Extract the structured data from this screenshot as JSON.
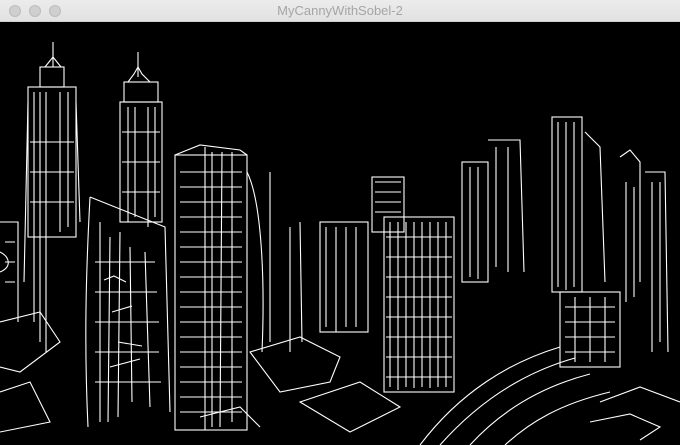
{
  "window": {
    "title": "MyCannyWithSobel-2",
    "controls": {
      "close": "close-button",
      "minimize": "minimize-button",
      "zoom": "zoom-button"
    }
  },
  "image": {
    "description_icon": "edge-detected-cityscape",
    "background_color": "#000000",
    "edge_color": "#ffffff"
  }
}
